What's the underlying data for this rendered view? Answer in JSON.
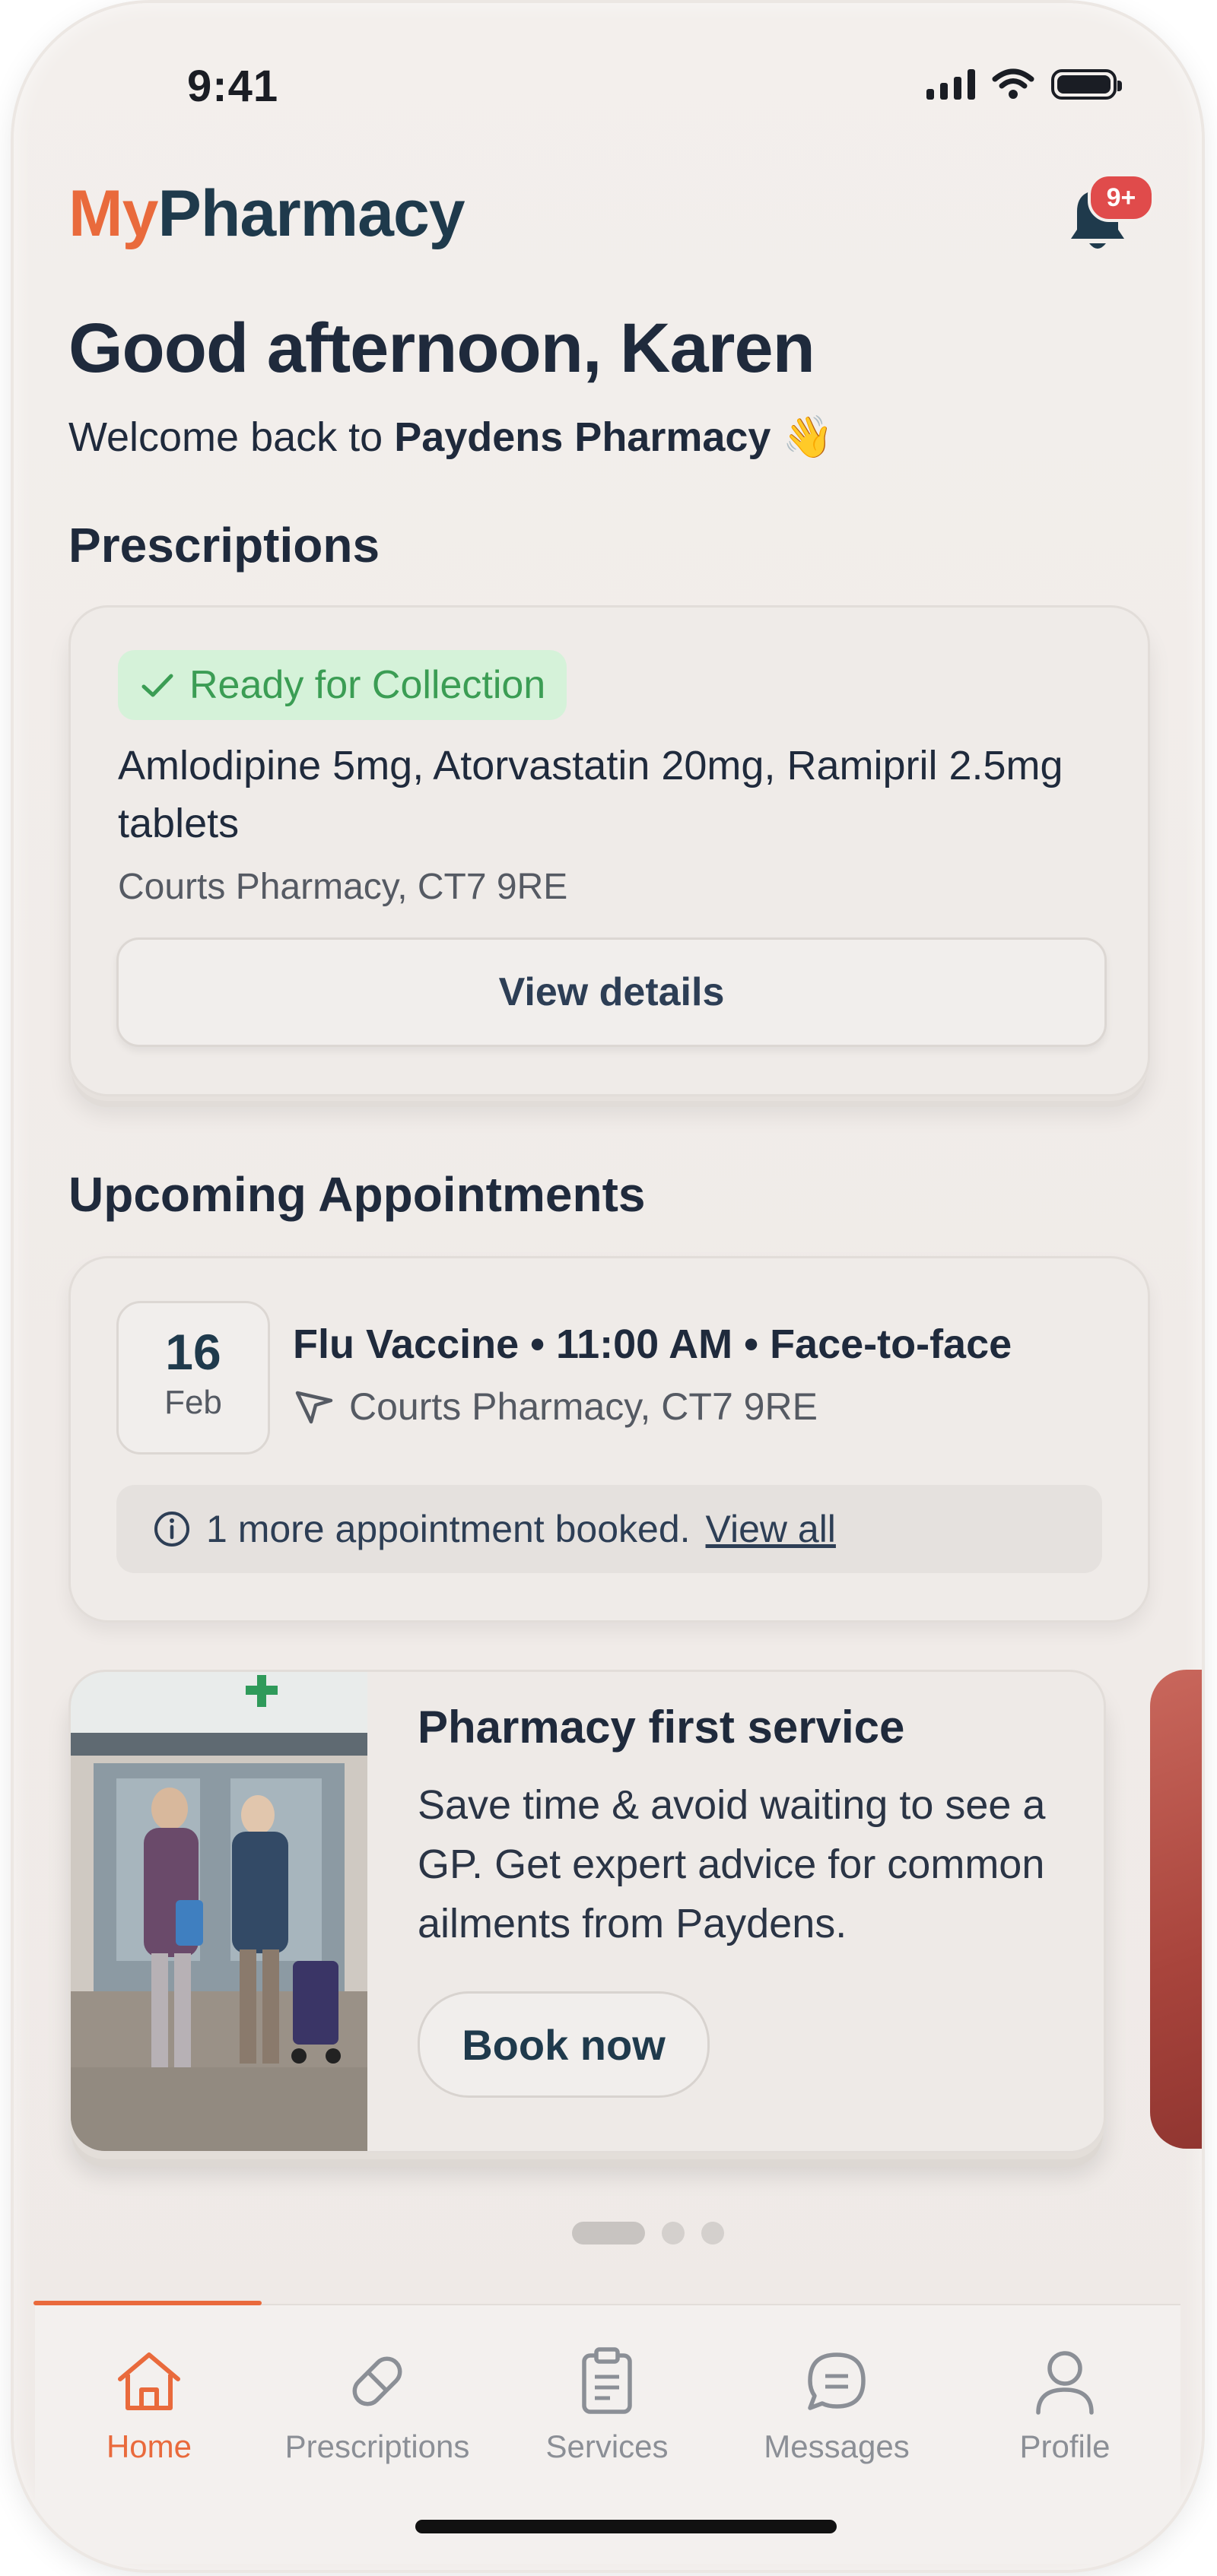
{
  "status_bar": {
    "time": "9:41"
  },
  "header": {
    "logo_part1": "My",
    "logo_part2": "Pharmacy",
    "notification_badge": "9+"
  },
  "greeting": {
    "title": "Good afternoon, Karen",
    "welcome_prefix": "Welcome back to ",
    "pharmacy_name": "Paydens Pharmacy",
    "emoji": "👋"
  },
  "prescriptions": {
    "section_title": "Prescriptions",
    "status": "Ready for Collection",
    "medicines": "Amlodipine 5mg, Atorvastatin 20mg, Ramipril 2.5mg tablets",
    "location": "Courts Pharmacy, CT7 9RE",
    "button_label": "View details"
  },
  "appointments": {
    "section_title": "Upcoming Appointments",
    "day": "16",
    "month": "Feb",
    "title": "Flu Vaccine • 11:00 AM • Face-to-face",
    "location": "Courts Pharmacy, CT7 9RE",
    "more_text": "1 more appointment booked.",
    "more_link": "View all"
  },
  "promo": {
    "title": "Pharmacy first service",
    "text": "Save time & avoid waiting to see a GP. Get expert advice for common ailments from Paydens.",
    "button_label": "Book now"
  },
  "carousel": {
    "count": 3,
    "active_index": 0
  },
  "tabs": [
    {
      "label": "Home",
      "icon": "home-icon",
      "active": true
    },
    {
      "label": "Prescriptions",
      "icon": "pill-icon",
      "active": false
    },
    {
      "label": "Services",
      "icon": "clipboard-icon",
      "active": false
    },
    {
      "label": "Messages",
      "icon": "chat-icon",
      "active": false
    },
    {
      "label": "Profile",
      "icon": "user-icon",
      "active": false
    }
  ],
  "colors": {
    "brand_orange": "#e96a3c",
    "brand_navy": "#1f3a4c",
    "ready_green": "#3b9d54",
    "badge_red": "#e04b4b"
  }
}
